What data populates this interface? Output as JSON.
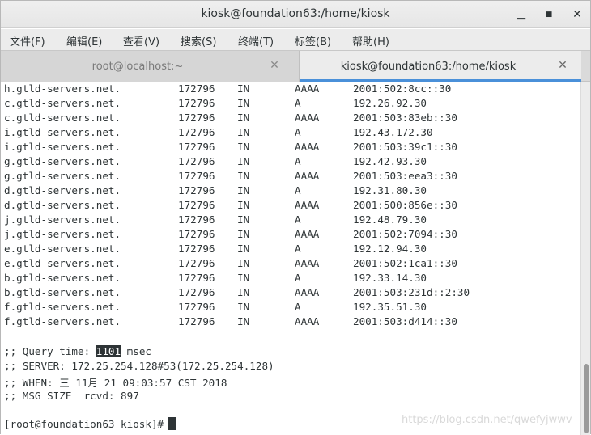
{
  "window": {
    "title": "kiosk@foundation63:/home/kiosk",
    "controls": {
      "minimize": "▁",
      "maximize": "■",
      "close": "✕"
    }
  },
  "menubar": {
    "items": [
      "文件(F)",
      "编辑(E)",
      "查看(V)",
      "搜索(S)",
      "终端(T)",
      "标签(B)",
      "帮助(H)"
    ]
  },
  "tabs": [
    {
      "label": "root@localhost:~",
      "active": false,
      "close": "✕"
    },
    {
      "label": "kiosk@foundation63:/home/kiosk",
      "active": true,
      "close": "✕"
    }
  ],
  "terminal": {
    "records": [
      {
        "name": "h.gtld-servers.net.",
        "ttl": "172796",
        "class": "IN",
        "type": "AAAA",
        "address": "2001:502:8cc::30"
      },
      {
        "name": "c.gtld-servers.net.",
        "ttl": "172796",
        "class": "IN",
        "type": "A",
        "address": "192.26.92.30"
      },
      {
        "name": "c.gtld-servers.net.",
        "ttl": "172796",
        "class": "IN",
        "type": "AAAA",
        "address": "2001:503:83eb::30"
      },
      {
        "name": "i.gtld-servers.net.",
        "ttl": "172796",
        "class": "IN",
        "type": "A",
        "address": "192.43.172.30"
      },
      {
        "name": "i.gtld-servers.net.",
        "ttl": "172796",
        "class": "IN",
        "type": "AAAA",
        "address": "2001:503:39c1::30"
      },
      {
        "name": "g.gtld-servers.net.",
        "ttl": "172796",
        "class": "IN",
        "type": "A",
        "address": "192.42.93.30"
      },
      {
        "name": "g.gtld-servers.net.",
        "ttl": "172796",
        "class": "IN",
        "type": "AAAA",
        "address": "2001:503:eea3::30"
      },
      {
        "name": "d.gtld-servers.net.",
        "ttl": "172796",
        "class": "IN",
        "type": "A",
        "address": "192.31.80.30"
      },
      {
        "name": "d.gtld-servers.net.",
        "ttl": "172796",
        "class": "IN",
        "type": "AAAA",
        "address": "2001:500:856e::30"
      },
      {
        "name": "j.gtld-servers.net.",
        "ttl": "172796",
        "class": "IN",
        "type": "A",
        "address": "192.48.79.30"
      },
      {
        "name": "j.gtld-servers.net.",
        "ttl": "172796",
        "class": "IN",
        "type": "AAAA",
        "address": "2001:502:7094::30"
      },
      {
        "name": "e.gtld-servers.net.",
        "ttl": "172796",
        "class": "IN",
        "type": "A",
        "address": "192.12.94.30"
      },
      {
        "name": "e.gtld-servers.net.",
        "ttl": "172796",
        "class": "IN",
        "type": "AAAA",
        "address": "2001:502:1ca1::30"
      },
      {
        "name": "b.gtld-servers.net.",
        "ttl": "172796",
        "class": "IN",
        "type": "A",
        "address": "192.33.14.30"
      },
      {
        "name": "b.gtld-servers.net.",
        "ttl": "172796",
        "class": "IN",
        "type": "AAAA",
        "address": "2001:503:231d::2:30"
      },
      {
        "name": "f.gtld-servers.net.",
        "ttl": "172796",
        "class": "IN",
        "type": "A",
        "address": "192.35.51.30"
      },
      {
        "name": "f.gtld-servers.net.",
        "ttl": "172796",
        "class": "IN",
        "type": "AAAA",
        "address": "2001:503:d414::30"
      }
    ],
    "query_time_prefix": ";; Query time: ",
    "query_time_value": "1101",
    "query_time_suffix": " msec",
    "server_line": ";; SERVER: 172.25.254.128#53(172.25.254.128)",
    "when_line": ";; WHEN: 三 11月 21 09:03:57 CST 2018",
    "msg_size_line": ";; MSG SIZE  rcvd: 897",
    "prompt": "[root@foundation63 kiosk]#"
  },
  "watermark": "https://blog.csdn.net/qwefyjwwv"
}
